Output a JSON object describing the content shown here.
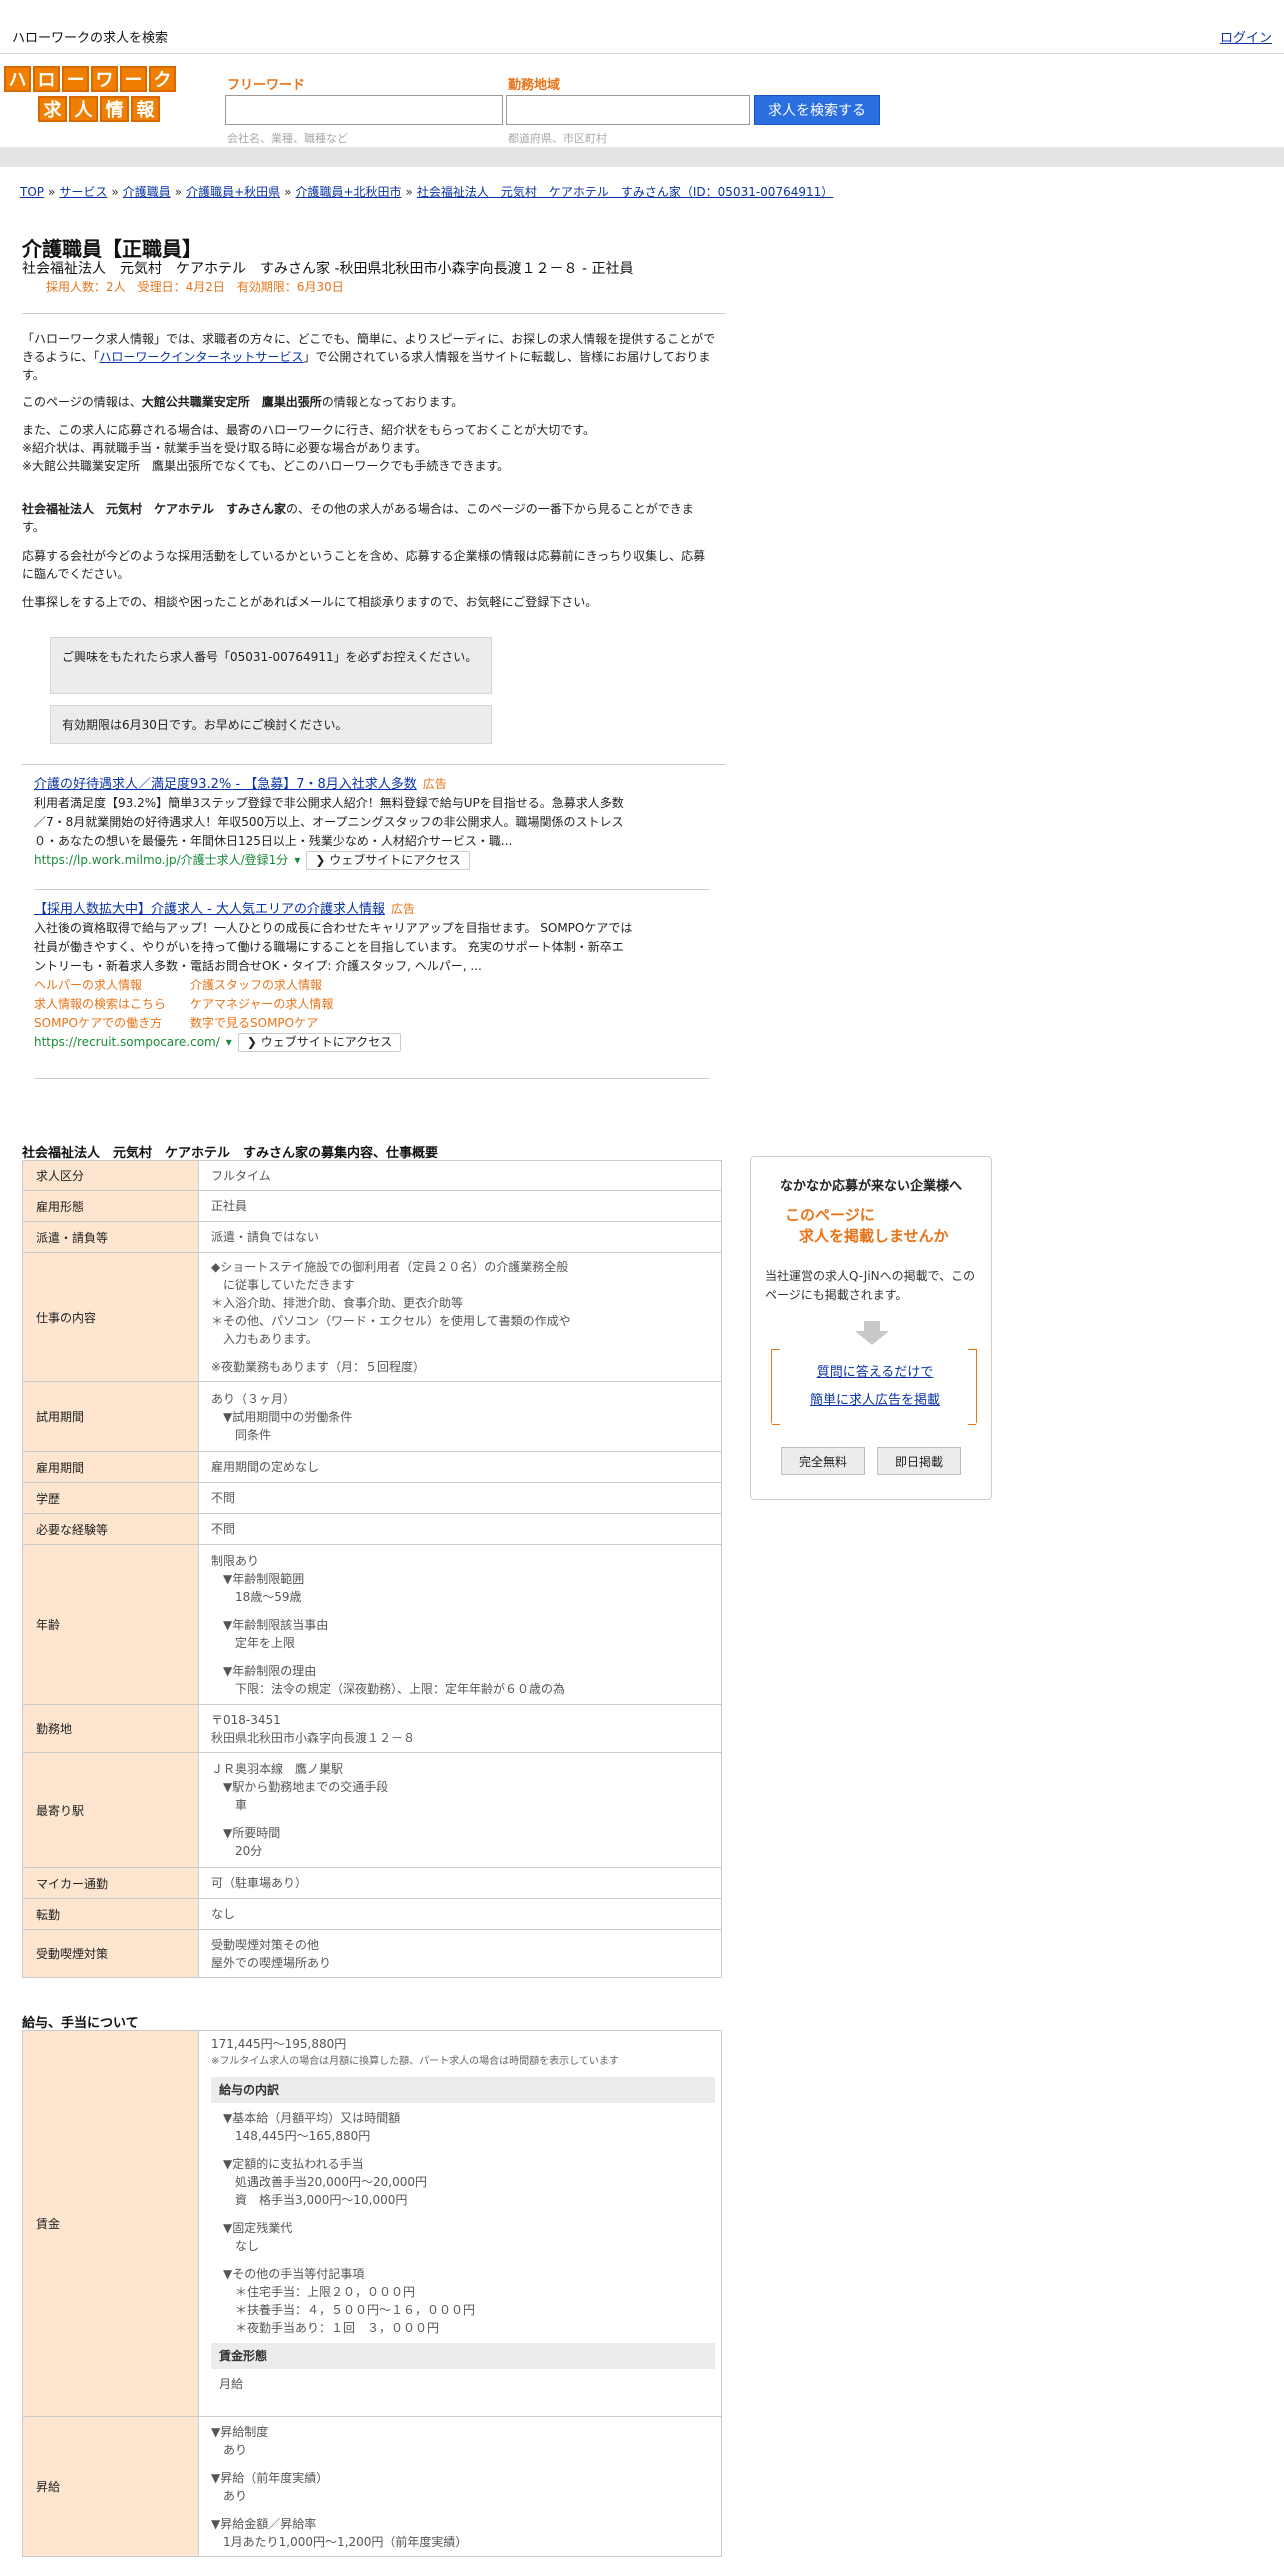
{
  "topbar": {
    "title": "ハローワークの求人を検索",
    "login": "ログイン"
  },
  "header": {
    "logo_row1": [
      "ハ",
      "ロ",
      "ー",
      "ワ",
      "ー",
      "ク"
    ],
    "logo_row2": [
      "求",
      "人",
      "情",
      "報"
    ],
    "freeword_label": "フリーワード",
    "freeword_hint": "会社名、業種、職種など",
    "area_label": "勤務地域",
    "area_hint": "都道府県、市区町村",
    "search_button": "求人を検索する"
  },
  "breadcrumb": [
    "TOP",
    "サービス",
    "介護職員",
    "介護職員+秋田県",
    "介護職員+北秋田市",
    "社会福祉法人　元気村　ケアホテル　すみさん家（ID：05031-00764911）"
  ],
  "job": {
    "title": "介護職員【正職員】",
    "company_line": "社会福祉法人　元気村　ケアホテル　すみさん家 -秋田県北秋田市小森字向長渡１２－８ - 正社員",
    "meta": "採用人数：2人　受理日：4月2日　有効期限：6月30日"
  },
  "intro": {
    "p1a": "「ハローワーク求人情報」では、求職者の方々に、どこでも、簡単に、よりスピーディに、お探しの求人情報を提供することができるように、「",
    "p1_link": "ハローワークインターネットサービス",
    "p1b": "」で公開されている求人情報を当サイトに転載し、皆様にお届けしております。",
    "p2a": "このページの情報は、",
    "p2_office": "大館公共職業安定所　鷹巣出張所",
    "p2b": "の情報となっております。",
    "p3": "また、この求人に応募される場合は、最寄のハローワークに行き、紹介状をもらっておくことが大切です。",
    "p4": "※紹介状は、再就職手当・就業手当を受け取る時に必要な場合があります。",
    "p5": "※大館公共職業安定所　鷹巣出張所でなくても、どこのハローワークでも手続きできます。",
    "p6_company": "社会福祉法人　元気村　ケアホテル　すみさん家",
    "p6b": "の、その他の求人がある場合は、このページの一番下から見ることができます。",
    "p7": "応募する会社が今どのような採用活動をしているかということを含め、応募する企業様の情報は応募前にきっちり収集し、応募に臨んでください。",
    "p8": "仕事探しをする上での、相談や困ったことがあればメールにて相談承りますので、お気軽にご登録下さい。"
  },
  "notices": {
    "number": "ご興味をもたれたら求人番号「05031-00764911」を必ずお控えください。",
    "expiry": "有効期限は6月30日です。お早めにご検討ください。"
  },
  "ads": [
    {
      "title": "介護の好待遇求人／満足度93.2% - 【急募】7・8月入社求人多数",
      "badge": "広告",
      "desc": "利用者満足度【93.2%】簡単3ステップ登録で非公開求人紹介！無料登録で給与UPを目指せる。急募求人多数／7・8月就業開始の好待遇求人！年収500万以上、オープニングスタッフの非公開求人。職場関係のストレス０・あなたの想いを最優先・年間休日125日以上・残業少なめ・人材紹介サービス・職...",
      "url": "https://lp.work.milmo.jp/介護士求人/登録1分",
      "visit": "ウェブサイトにアクセス"
    },
    {
      "title": "【採用人数拡大中】介護求人 - 大人気エリアの介護求人情報",
      "badge": "広告",
      "desc": "入社後の資格取得で給与アップ！一人ひとりの成長に合わせたキャリアアップを目指せます。 SOMPOケアでは社員が働きやすく、やりがいを持って働ける職場にすることを目指しています。 充実のサポート体制・新卒エントリーも・新着求人多数・電話お問合せOK・タイプ: 介護スタッフ, ヘルパー, ...",
      "sublinks": [
        "ヘルパーの求人情報",
        "介護スタッフの求人情報",
        "求人情報の検索はこちら",
        "ケアマネジャーの求人情報",
        "SOMPOケアでの働き方",
        "数字で見るSOMPOケア"
      ],
      "url": "https://recruit.sompocare.com/",
      "visit": "ウェブサイトにアクセス"
    }
  ],
  "details": {
    "title": "社会福祉法人　元気村　ケアホテル　すみさん家の募集内容、仕事概要",
    "rows": {
      "kyujin_kubun": {
        "label": "求人区分",
        "value": "フルタイム"
      },
      "koyo_keitai": {
        "label": "雇用形態",
        "value": "正社員"
      },
      "haken": {
        "label": "派遣・請負等",
        "value": "派遣・請負ではない"
      },
      "shigoto": {
        "label": "仕事の内容",
        "l1": "◆ショートステイ施設での御利用者（定員２０名）の介護業務全般",
        "l2": "に従事していただきます",
        "l3": "＊入浴介助、排泄介助、食事介助、更衣介助等",
        "l4": "＊その他、パソコン（ワード・エクセル）を使用して書類の作成や",
        "l5": "入力もあります。",
        "l6": "※夜勤業務もあります（月：５回程度）"
      },
      "shiyo": {
        "label": "試用期間",
        "l1": "あり（３ヶ月）",
        "l2": "▼試用期間中の労働条件",
        "l3": "同条件"
      },
      "koyo_kikan": {
        "label": "雇用期間",
        "value": "雇用期間の定めなし"
      },
      "gakureki": {
        "label": "学歴",
        "value": "不問"
      },
      "keiken": {
        "label": "必要な経験等",
        "value": "不問"
      },
      "nenrei": {
        "label": "年齢",
        "l1": "制限あり",
        "l2": "▼年齢制限範囲",
        "l3": "18歳〜59歳",
        "l4": "▼年齢制限該当事由",
        "l5": "定年を上限",
        "l6": "▼年齢制限の理由",
        "l7": "下限：法令の規定（深夜勤務）、上限：定年年齢が６０歳の為"
      },
      "kinmuchi": {
        "label": "勤務地",
        "l1": "〒018-3451",
        "l2": "秋田県北秋田市小森字向長渡１２－８"
      },
      "moyori": {
        "label": "最寄り駅",
        "l1": "ＪＲ奥羽本線　鷹ノ巣駅",
        "l2": "▼駅から勤務地までの交通手段",
        "l3": "車",
        "l4": "▼所要時間",
        "l5": "20分"
      },
      "mycar": {
        "label": "マイカー通勤",
        "value": "可（駐車場あり）"
      },
      "tenkin": {
        "label": "転勤",
        "value": "なし"
      },
      "judo": {
        "label": "受動喫煙対策",
        "l1": "受動喫煙対策その他",
        "l2": "屋外での喫煙場所あり"
      }
    }
  },
  "salary": {
    "title": "給与、手当について",
    "chingin": {
      "label": "賃金",
      "range": "171,445円〜195,880円",
      "note": "※フルタイム求人の場合は月額に換算した額、パート求人の場合は時間額を表示しています",
      "breakdown_title": "給与の内訳",
      "b1": "▼基本給（月額平均）又は時間額",
      "b2": "148,445円〜165,880円",
      "b3": "▼定額的に支払われる手当",
      "b4": "処遇改善手当20,000円〜20,000円",
      "b5": "資　格手当3,000円〜10,000円",
      "b6": "▼固定残業代",
      "b7": "なし",
      "b8": "▼その他の手当等付記事項",
      "b9": "＊住宅手当：上限２０，０００円",
      "b10": "＊扶養手当：４，５００円～１６，０００円",
      "b11": "＊夜勤手当あり：１回　３，０００円",
      "form_title": "賃金形態",
      "form": "月給"
    },
    "shokyu": {
      "label": "昇給",
      "l1": "▼昇給制度",
      "l2": "あり",
      "l3": "▼昇給（前年度実績）",
      "l4": "あり",
      "l5": "▼昇給金額／昇給率",
      "l6": "1月あたり1,000円〜1,200円（前年度実績）"
    }
  },
  "side": {
    "title": "なかなか応募が来ない企業様へ",
    "catch1": "このページに",
    "catch2": "求人を掲載しませんか",
    "desc": "当社運営の求人Q-JiNへの掲載で、このページにも掲載されます。",
    "link1": "質問に答えるだけで",
    "link2": "簡単に求人広告を掲載",
    "btn_free": "完全無料",
    "btn_now": "即日掲載"
  },
  "colors": {
    "accent_orange": "#e8741a",
    "link_blue": "#0b34a5",
    "search_blue": "#2a6ee0",
    "table_header": "#fde5d0"
  }
}
